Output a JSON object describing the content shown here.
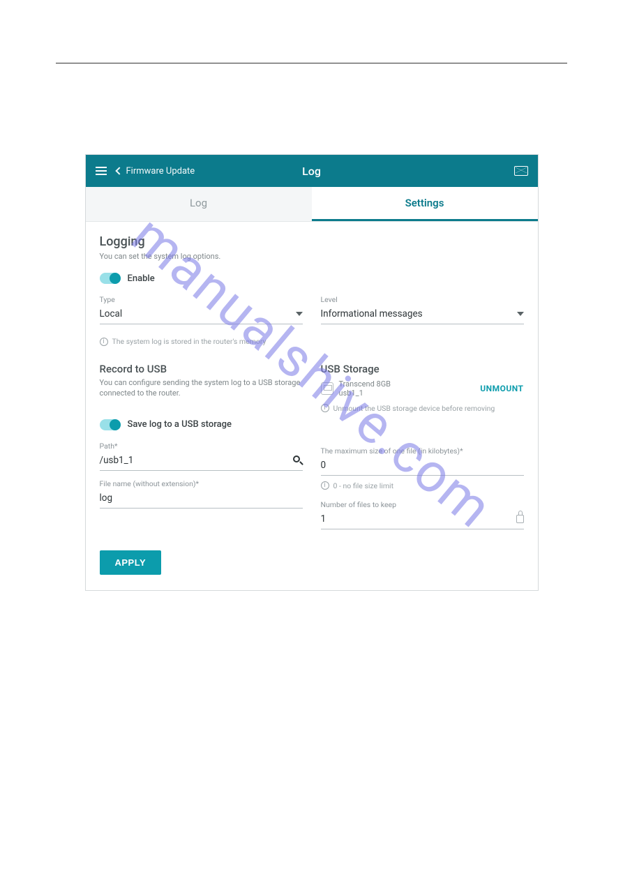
{
  "header": {
    "breadcrumb": "Firmware Update",
    "title": "Log"
  },
  "tabs": {
    "log": "Log",
    "settings": "Settings"
  },
  "logging": {
    "title": "Logging",
    "desc": "You can set the system log options.",
    "enable_label": "Enable",
    "type_label": "Type",
    "type_value": "Local",
    "level_label": "Level",
    "level_value": "Informational messages",
    "storage_note": "The system log is stored in the router's memory"
  },
  "record_usb": {
    "title": "Record to USB",
    "desc": "You can configure sending the system log to a USB storage connected to the router.",
    "save_toggle_label": "Save log to a USB storage",
    "path_label": "Path*",
    "path_value": "/usb1_1",
    "filename_label": "File name (without extension)*",
    "filename_value": "log"
  },
  "usb_storage": {
    "title": "USB Storage",
    "device_name": "Transcend 8GB",
    "device_mount": "usb1_1",
    "unmount_label": "UNMOUNT",
    "unmount_note": "Unmount the USB storage device before removing",
    "maxsize_label": "The maximum size of one file (in kilobytes)*",
    "maxsize_value": "0",
    "maxsize_note": "0 - no file size limit",
    "keep_label": "Number of files to keep",
    "keep_value": "1"
  },
  "buttons": {
    "apply": "APPLY"
  },
  "watermark": "manualshive.com"
}
